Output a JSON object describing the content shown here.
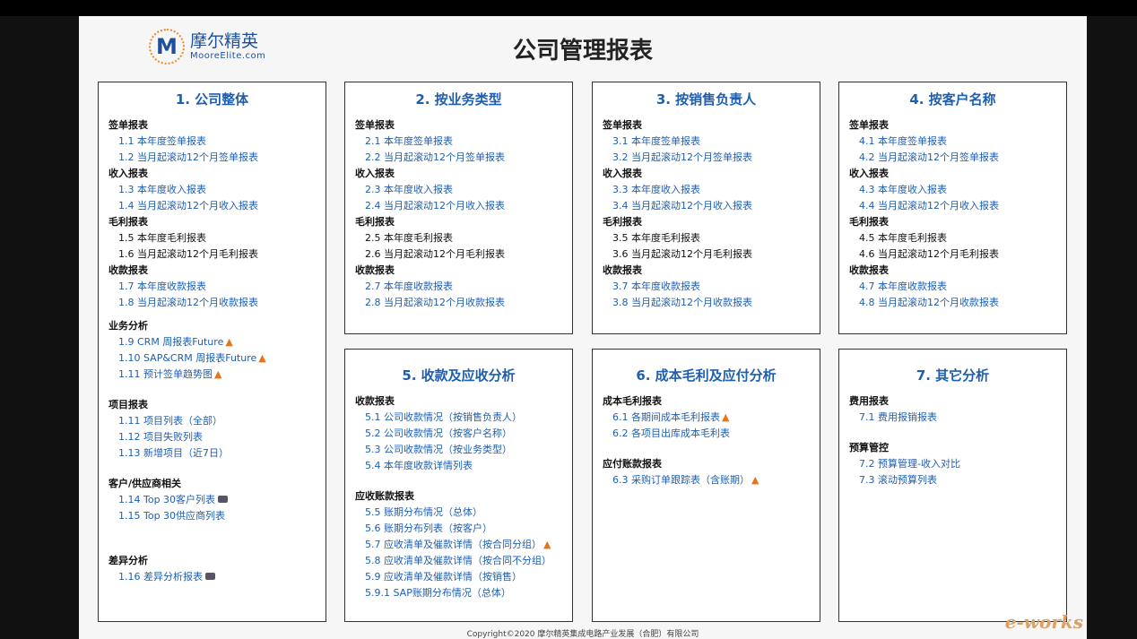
{
  "logo": {
    "mark": "M",
    "cn": "摩尔精英",
    "en": "MooreElite.com"
  },
  "title": "公司管理报表",
  "footer": "Copyright©2020 摩尔精英集成电路产业发展（合肥）有限公司",
  "corner_logo": "e-works",
  "panels": [
    {
      "title": "1. 公司整体",
      "lines": [
        [
          "sec",
          "签单报表"
        ],
        [
          "link",
          "1.1 本年度签单报表"
        ],
        [
          "link",
          "1.2 当月起滚动12个月签单报表"
        ],
        [
          "sec",
          "收入报表"
        ],
        [
          "link",
          "1.3 本年度收入报表"
        ],
        [
          "link",
          "1.4 当月起滚动12个月收入报表"
        ],
        [
          "sec",
          "毛利报表"
        ],
        [
          "black",
          "1.5 本年度毛利报表"
        ],
        [
          "black",
          "1.6 当月起滚动12个月毛利报表"
        ],
        [
          "sec",
          "收款报表"
        ],
        [
          "link",
          "1.7 本年度收款报表"
        ],
        [
          "link",
          "1.8 当月起滚动12个月收款报表"
        ],
        [
          "gap",
          ""
        ],
        [
          "sec",
          "业务分析"
        ],
        [
          "link",
          "1.9 CRM 周报表Future",
          "fire"
        ],
        [
          "link",
          "1.10 SAP&CRM 周报表Future",
          "fire"
        ],
        [
          "link",
          "1.11 预计签单趋势图",
          "fire"
        ],
        [
          "gap2",
          ""
        ],
        [
          "sec",
          "项目报表"
        ],
        [
          "link",
          "1.11 项目列表（全部）"
        ],
        [
          "link",
          "1.12 项目失败列表"
        ],
        [
          "link",
          "1.13 新增项目（近7日）"
        ],
        [
          "gap2",
          ""
        ],
        [
          "sec",
          "客户/供应商相关"
        ],
        [
          "link",
          "1.14 Top 30客户列表",
          "badge"
        ],
        [
          "link",
          "1.15 Top 30供应商列表"
        ],
        [
          "gap2",
          ""
        ],
        [
          "gap2",
          ""
        ],
        [
          "sec",
          "差异分析"
        ],
        [
          "link",
          "1.16 差异分析报表",
          "badge"
        ]
      ]
    },
    {
      "title": "2. 按业务类型",
      "lines": [
        [
          "sec",
          "签单报表"
        ],
        [
          "link",
          "2.1 本年度签单报表"
        ],
        [
          "link",
          "2.2 当月起滚动12个月签单报表"
        ],
        [
          "sec",
          "收入报表"
        ],
        [
          "link",
          "2.3 本年度收入报表"
        ],
        [
          "link",
          "2.4 当月起滚动12个月收入报表"
        ],
        [
          "sec",
          "毛利报表"
        ],
        [
          "black",
          "2.5 本年度毛利报表"
        ],
        [
          "black",
          "2.6 当月起滚动12个月毛利报表"
        ],
        [
          "sec",
          "收款报表"
        ],
        [
          "link",
          "2.7 本年度收款报表"
        ],
        [
          "link",
          "2.8 当月起滚动12个月收款报表"
        ]
      ]
    },
    {
      "title": "3. 按销售负责人",
      "lines": [
        [
          "sec",
          "签单报表"
        ],
        [
          "link",
          "3.1 本年度签单报表"
        ],
        [
          "link",
          "3.2 当月起滚动12个月签单报表"
        ],
        [
          "sec",
          "收入报表"
        ],
        [
          "link",
          "3.3 本年度收入报表"
        ],
        [
          "link",
          "3.4 当月起滚动12个月收入报表"
        ],
        [
          "sec",
          "毛利报表"
        ],
        [
          "black",
          "3.5 本年度毛利报表"
        ],
        [
          "black",
          "3.6 当月起滚动12个月毛利报表"
        ],
        [
          "sec",
          "收款报表"
        ],
        [
          "link",
          "3.7 本年度收款报表"
        ],
        [
          "link",
          "3.8 当月起滚动12个月收款报表"
        ]
      ]
    },
    {
      "title": "4. 按客户名称",
      "lines": [
        [
          "sec",
          "签单报表"
        ],
        [
          "link",
          "4.1 本年度签单报表"
        ],
        [
          "link",
          "4.2 当月起滚动12个月签单报表"
        ],
        [
          "sec",
          "收入报表"
        ],
        [
          "link",
          "4.3 本年度收入报表"
        ],
        [
          "link",
          "4.4 当月起滚动12个月收入报表"
        ],
        [
          "sec",
          "毛利报表"
        ],
        [
          "black",
          "4.5 本年度毛利报表"
        ],
        [
          "black",
          "4.6 当月起滚动12个月毛利报表"
        ],
        [
          "sec",
          "收款报表"
        ],
        [
          "link",
          "4.7 本年度收款报表"
        ],
        [
          "link",
          "4.8 当月起滚动12个月收款报表"
        ]
      ]
    },
    {
      "title": "5. 收款及应收分析",
      "lines": [
        [
          "sec",
          "收款报表"
        ],
        [
          "link",
          "5.1 公司收款情况（按销售负责人）"
        ],
        [
          "link",
          "5.2 公司收款情况（按客户名称）"
        ],
        [
          "link",
          "5.3 公司收款情况（按业务类型）"
        ],
        [
          "link",
          "5.4 本年度收款详情列表"
        ],
        [
          "gap2",
          ""
        ],
        [
          "sec",
          "应收账款报表"
        ],
        [
          "link",
          "5.5 账期分布情况（总体）"
        ],
        [
          "link",
          "5.6 账期分布列表（按客户）"
        ],
        [
          "link",
          "5.7 应收清单及催款详情（按合同分组）",
          "fire"
        ],
        [
          "link",
          "5.8 应收清单及催款详情（按合同不分组）"
        ],
        [
          "link",
          "5.9 应收清单及催款详情（按销售）"
        ],
        [
          "link",
          "5.9.1 SAP账期分布情况（总体）"
        ]
      ]
    },
    {
      "title": "6. 成本毛利及应付分析",
      "lines": [
        [
          "sec",
          "成本毛利报表"
        ],
        [
          "link",
          "6.1 各期间成本毛利报表",
          "fire"
        ],
        [
          "link",
          "6.2 各项目出库成本毛利表"
        ],
        [
          "gap2",
          ""
        ],
        [
          "sec",
          "应付账款报表"
        ],
        [
          "link",
          "6.3 采购订单跟踪表（含账期）",
          "fire"
        ]
      ]
    },
    {
      "title": "7. 其它分析",
      "lines": [
        [
          "sec",
          "费用报表"
        ],
        [
          "link",
          "7.1 费用报销报表"
        ],
        [
          "gap2",
          ""
        ],
        [
          "sec",
          "预算管控"
        ],
        [
          "link",
          "7.2 预算管理-收入对比"
        ],
        [
          "link",
          "7.3 滚动预算列表"
        ]
      ]
    }
  ]
}
